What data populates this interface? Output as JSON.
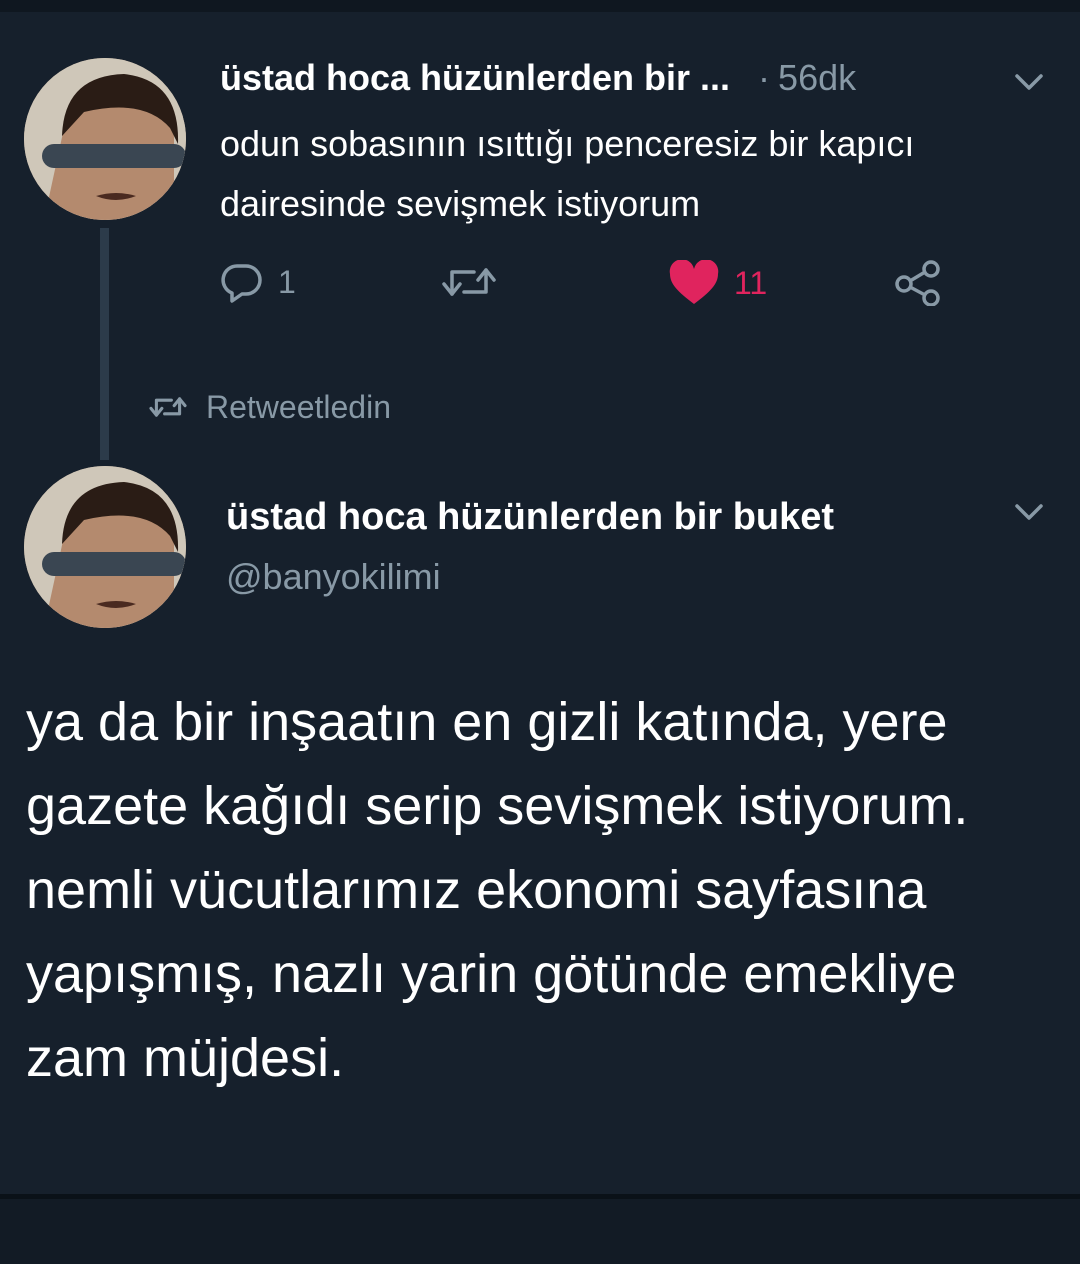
{
  "colors": {
    "background": "#16202c",
    "text_primary": "#ffffff",
    "text_secondary": "#8899a6",
    "like_accent": "#e0245e"
  },
  "reply_tweet": {
    "author_display": "üstad hoca hüzünlerden bir ...",
    "separator": "·",
    "time_ago": "56dk",
    "text": "odun sobasının ısıttığı penceresiz bir kapıcı dairesinde sevişmek istiyorum",
    "actions": {
      "reply_count": "1",
      "retweet_count": "",
      "like_count": "11",
      "like_state": "liked"
    },
    "icons": [
      "reply-icon",
      "retweet-icon",
      "heart-icon",
      "share-icon",
      "chevron-down-icon"
    ]
  },
  "retweet_notice": {
    "label": "Retweetledin",
    "icon": "retweet-icon"
  },
  "main_tweet": {
    "display_name": "üstad hoca hüzünlerden bir buket",
    "handle": "@banyokilimi",
    "text": "ya da bir inşaatın en gizli katında, yere gazete kağıdı serip sevişmek istiyorum. nemli vücutlarımız ekonomi sayfasına yapışmış, nazlı yarin götünde emekliye zam müjdesi.",
    "icons": [
      "chevron-down-icon"
    ]
  }
}
